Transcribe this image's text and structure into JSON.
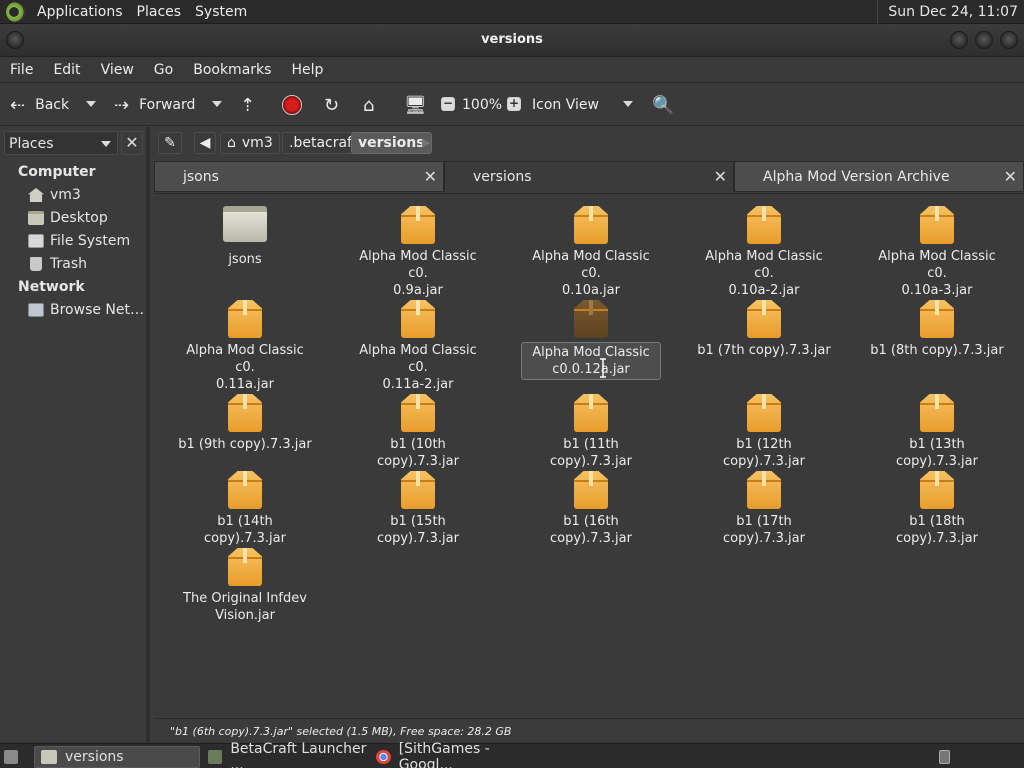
{
  "top_panel": {
    "menus": [
      "Applications",
      "Places",
      "System"
    ],
    "clock": "Sun Dec 24, 11:07"
  },
  "window": {
    "title": "versions"
  },
  "menubar": [
    "File",
    "Edit",
    "View",
    "Go",
    "Bookmarks",
    "Help"
  ],
  "toolbar": {
    "back_label": "Back",
    "forward_label": "Forward",
    "zoom_level": "100%",
    "view_mode": "Icon View"
  },
  "sidebar": {
    "header": "Places",
    "sections": [
      {
        "title": "Computer",
        "items": [
          "vm3",
          "Desktop",
          "File System",
          "Trash"
        ]
      },
      {
        "title": "Network",
        "items": [
          "Browse Net…"
        ]
      }
    ]
  },
  "location": {
    "crumbs": [
      "vm3",
      ".betacraft",
      "versions"
    ]
  },
  "tabs": [
    "jsons",
    "versions",
    "Alpha Mod Version Archive"
  ],
  "files": [
    "jsons",
    "Alpha Mod Classic c0.\n0.9a.jar",
    "Alpha Mod Classic c0.\n0.10a.jar",
    "Alpha Mod Classic c0.\n0.10a-2.jar",
    "Alpha Mod Classic c0.\n0.10a-3.jar",
    "Alpha Mod Classic c0.\n0.11a.jar",
    "Alpha Mod Classic c0.\n0.11a-2.jar",
    "Alpha Mod Classic\nc0.0.12a.jar",
    "b1 (7th copy).7.3.jar",
    "b1 (8th copy).7.3.jar",
    "b1 (9th copy).7.3.jar",
    "b1 (10th copy).7.3.jar",
    "b1 (11th copy).7.3.jar",
    "b1 (12th copy).7.3.jar",
    "b1 (13th copy).7.3.jar",
    "b1 (14th copy).7.3.jar",
    "b1 (15th copy).7.3.jar",
    "b1 (16th copy).7.3.jar",
    "b1 (17th copy).7.3.jar",
    "b1 (18th copy).7.3.jar",
    "The Original Infdev\nVision.jar"
  ],
  "status": "\"b1 (6th copy).7.3.jar\" selected (1.5 MB), Free space: 28.2 GB",
  "taskbar": [
    "versions",
    "BetaCraft Launcher ...",
    "[SithGames - Googl..."
  ]
}
